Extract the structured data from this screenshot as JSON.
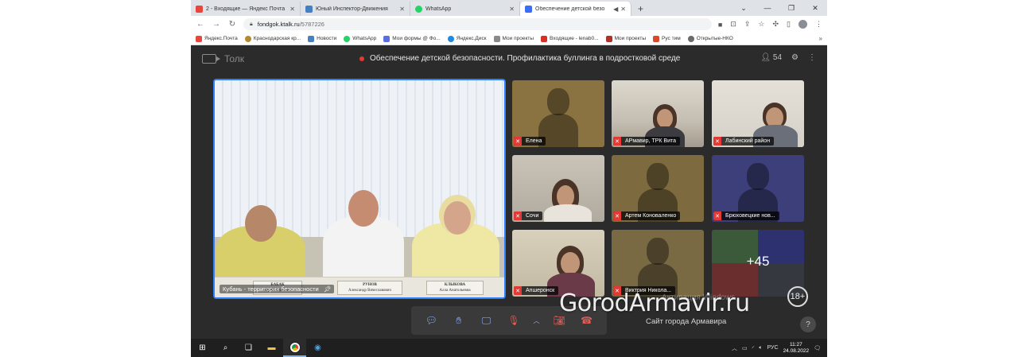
{
  "browser": {
    "tabs": [
      {
        "label": "2 - Входящие — Яндекс Почта",
        "color": "#e8453c"
      },
      {
        "label": "Юный Инспектор-Движения",
        "color": "#4680c2"
      },
      {
        "label": "WhatsApp",
        "color": "#25d366"
      },
      {
        "label": "Обеспечение детской безо",
        "color": "#3b6ef5",
        "active": true
      }
    ],
    "url_host": "fondgok.ktalk.ru",
    "url_path": "/5787226",
    "bookmarks": [
      {
        "label": "Яндекс.Почта",
        "color": "#e8453c"
      },
      {
        "label": "Краснодарская кр...",
        "color": "#b38a2e"
      },
      {
        "label": "Новости",
        "color": "#4680c2"
      },
      {
        "label": "WhatsApp",
        "color": "#25d366"
      },
      {
        "label": "Мои формы @ Фо...",
        "color": "#5b6ee1"
      },
      {
        "label": "Яндекс.Диск",
        "color": "#1e88e5"
      },
      {
        "label": "Мои проекты",
        "color": "#8a8a8a"
      },
      {
        "label": "Входящие - lenab0...",
        "color": "#d93025"
      },
      {
        "label": "Мои проекты",
        "color": "#b0302a"
      },
      {
        "label": "Рус тим",
        "color": "#d94a2b"
      },
      {
        "label": "Открытые-НКО",
        "color": "#6a6a6a"
      }
    ]
  },
  "app": {
    "brand": "Толк",
    "meeting_title": "Обеспечение детской безопасности. Профилактика буллинга в подростковой среде",
    "participants_count": "54",
    "accent": "#2f80ff"
  },
  "main_video": {
    "caption": "Кубань - территория безопасности",
    "nameplates": [
      {
        "line1": "БАБАК",
        "line2": "Юрий Юрьевич"
      },
      {
        "line1": "РУНОВ",
        "line2": "Александр Вячеславович"
      },
      {
        "line1": "КЛЫКОВА",
        "line2": "Алла Анатольевна"
      }
    ]
  },
  "tiles": [
    {
      "name": "Елена",
      "kind": "avatar",
      "bg": "#8a7340"
    },
    {
      "name": "АРмавир, ТРК Вита",
      "kind": "photo",
      "bg": "#c9c2b6"
    },
    {
      "name": "Лабинский район",
      "kind": "photo",
      "bg": "#d9d4cc"
    },
    {
      "name": "Сочи",
      "kind": "photo",
      "bg": "#b7b1a8"
    },
    {
      "name": "Артем Коноваленко",
      "kind": "avatar",
      "bg": "#7d6a3e"
    },
    {
      "name": "Брюховецкие нов...",
      "kind": "avatar",
      "bg": "#3d3f7a"
    },
    {
      "name": "Апшеронск",
      "kind": "photo",
      "bg": "#c8c2b4"
    },
    {
      "name": "Виктрия Никола...",
      "kind": "avatar",
      "bg": "#7a6a44"
    },
    {
      "name": "",
      "kind": "more",
      "bg": "#2f3b4a",
      "count": "+45"
    }
  ],
  "controls": [
    "chat-icon",
    "raise-hand-icon",
    "screen-share-icon",
    "mic-off-icon",
    "chevron-up-icon",
    "camera-off-icon",
    "hang-up-icon"
  ],
  "watermark": {
    "site": "GorodArmavir.ru",
    "subtitle": "Сайт города Армавира",
    "age": "18+"
  },
  "windows_notice": "Активация Windows",
  "help": "?",
  "taskbar": {
    "lang": "РУС",
    "time": "11:27",
    "date": "24.08.2022"
  }
}
